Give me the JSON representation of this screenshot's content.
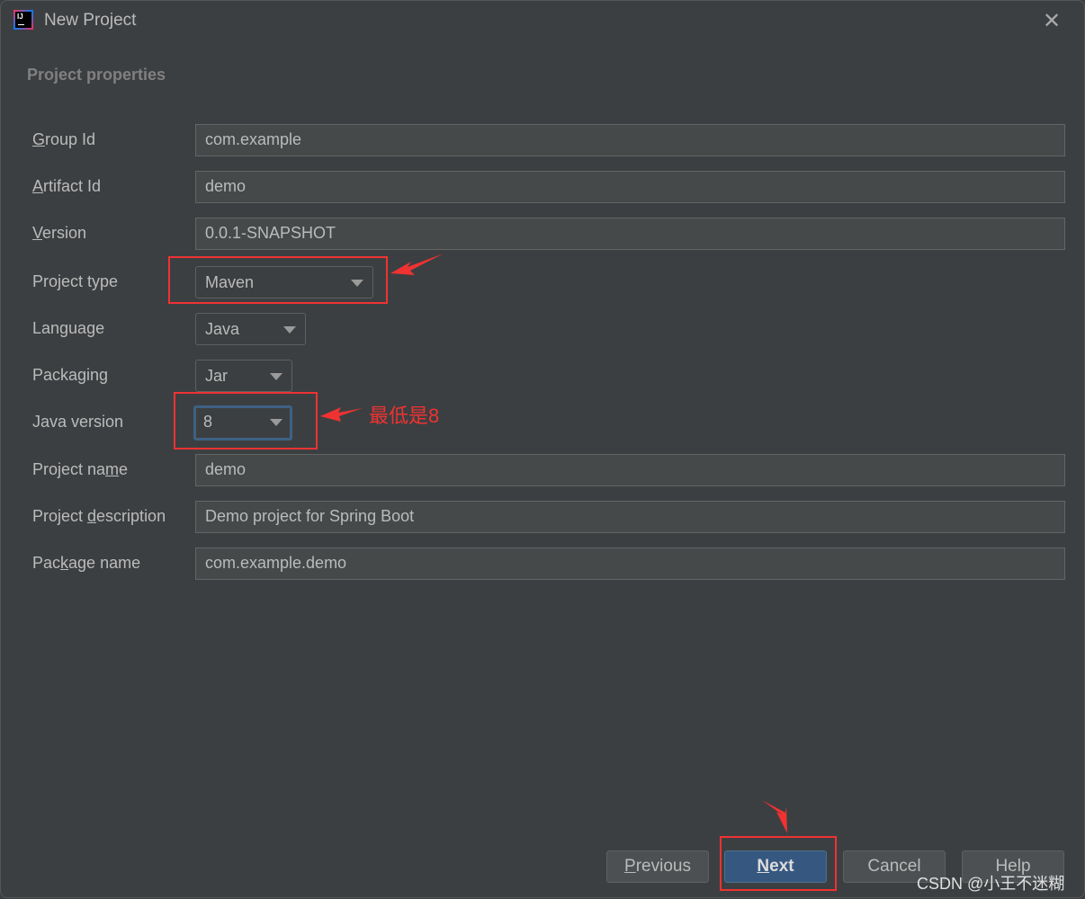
{
  "window": {
    "title": "New Project",
    "app_icon": "intellij-idea-icon",
    "close_icon": "close-icon"
  },
  "section_title": "Project properties",
  "fields": [
    {
      "label_pre": "",
      "label_key": "G",
      "label_post": "roup Id",
      "value": "com.example"
    },
    {
      "label_pre": "",
      "label_key": "A",
      "label_post": "rtifact Id",
      "value": "demo"
    },
    {
      "label_pre": "",
      "label_key": "V",
      "label_post": "ersion",
      "value": "0.0.1-SNAPSHOT"
    },
    {
      "label_pre": "Project type",
      "label_key": "",
      "label_post": "",
      "value": "Maven"
    },
    {
      "label_pre": "Language",
      "label_key": "",
      "label_post": "",
      "value": "Java"
    },
    {
      "label_pre": "Packaging",
      "label_key": "",
      "label_post": "",
      "value": "Jar"
    },
    {
      "label_pre": "Java version",
      "label_key": "",
      "label_post": "",
      "value": "8"
    },
    {
      "label_pre": "Project na",
      "label_key": "m",
      "label_post": "e",
      "value": "demo"
    },
    {
      "label_pre": "Project ",
      "label_key": "d",
      "label_post": "escription",
      "value": "Demo project for Spring Boot"
    },
    {
      "label_pre": "Pac",
      "label_key": "k",
      "label_post": "age name",
      "value": "com.example.demo"
    }
  ],
  "annotation_note": "最低是8",
  "buttons": {
    "previous": {
      "pre": "",
      "key": "P",
      "post": "revious"
    },
    "next": {
      "pre": "",
      "key": "N",
      "post": "ext"
    },
    "cancel": "Cancel",
    "help": "Help"
  },
  "watermark": "CSDN @小王不迷糊",
  "colors": {
    "background": "#3c3f41",
    "primary_button": "#365880",
    "annotation": "#f03232",
    "focus": "#3d6185"
  }
}
